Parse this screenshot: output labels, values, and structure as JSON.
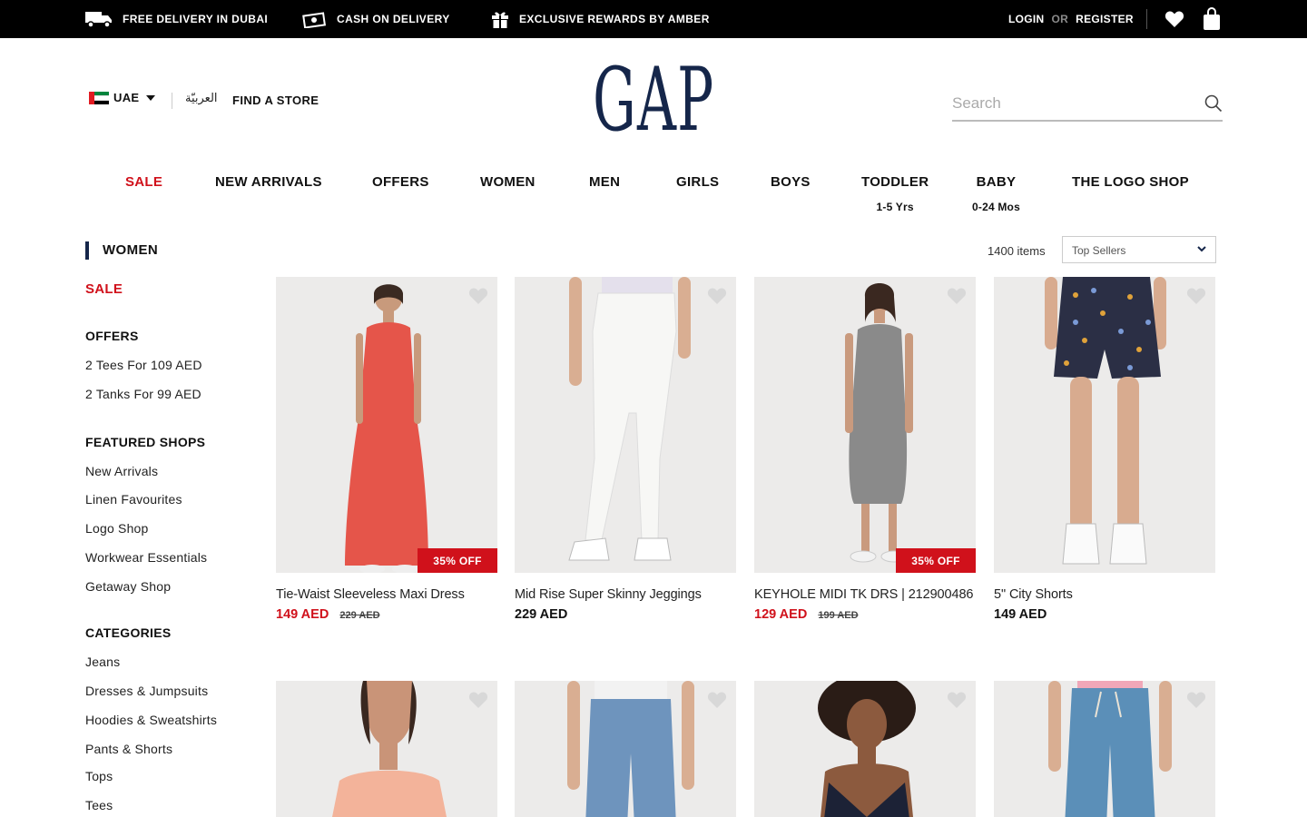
{
  "topbar": {
    "promos": [
      "FREE DELIVERY IN DUBAI",
      "CASH ON DELIVERY",
      "EXCLUSIVE REWARDS BY AMBER"
    ],
    "login": "LOGIN",
    "or": "OR",
    "register": "REGISTER"
  },
  "header": {
    "country": "UAE",
    "arabic_label": "العربيّة",
    "find_store": "FIND A STORE",
    "logo_text": "GAP",
    "search_placeholder": "Search"
  },
  "nav": [
    {
      "label": "SALE"
    },
    {
      "label": "NEW ARRIVALS"
    },
    {
      "label": "OFFERS"
    },
    {
      "label": "WOMEN"
    },
    {
      "label": "MEN"
    },
    {
      "label": "GIRLS"
    },
    {
      "label": "BOYS"
    },
    {
      "label": "TODDLER",
      "sub": "1-5 Yrs"
    },
    {
      "label": "BABY",
      "sub": "0-24 Mos"
    },
    {
      "label": "THE LOGO SHOP"
    }
  ],
  "sidebar": {
    "title": "WOMEN",
    "sale": "SALE",
    "offers_heading": "OFFERS",
    "offers": [
      "2 Tees For 109 AED",
      "2 Tanks For 99 AED"
    ],
    "featured_heading": "FEATURED SHOPS",
    "featured": [
      "New Arrivals",
      "Linen Favourites",
      "Logo Shop",
      "Workwear Essentials",
      "Getaway Shop"
    ],
    "categories_heading": "CATEGORIES",
    "categories": [
      "Jeans",
      "Dresses & Jumpsuits",
      "Hoodies & Sweatshirts",
      "Pants & Shorts",
      "Tops",
      "Tees"
    ]
  },
  "results": {
    "count": "1400 items",
    "sort_value": "Top Sellers"
  },
  "products": [
    {
      "name": "Tie-Waist Sleeveless Maxi Dress",
      "price": "149 AED",
      "was": "229 AED",
      "badge": "35% OFF"
    },
    {
      "name": "Mid Rise Super Skinny Jeggings",
      "price": "229 AED"
    },
    {
      "name": "KEYHOLE MIDI TK DRS | 212900486",
      "price": "129 AED",
      "was": "199 AED",
      "badge": "35% OFF"
    },
    {
      "name": "5\" City Shorts",
      "price": "149 AED"
    }
  ],
  "colors": {
    "sale_red": "#d0111b",
    "brand_navy": "#15264a",
    "topbar_bg": "#000000"
  }
}
